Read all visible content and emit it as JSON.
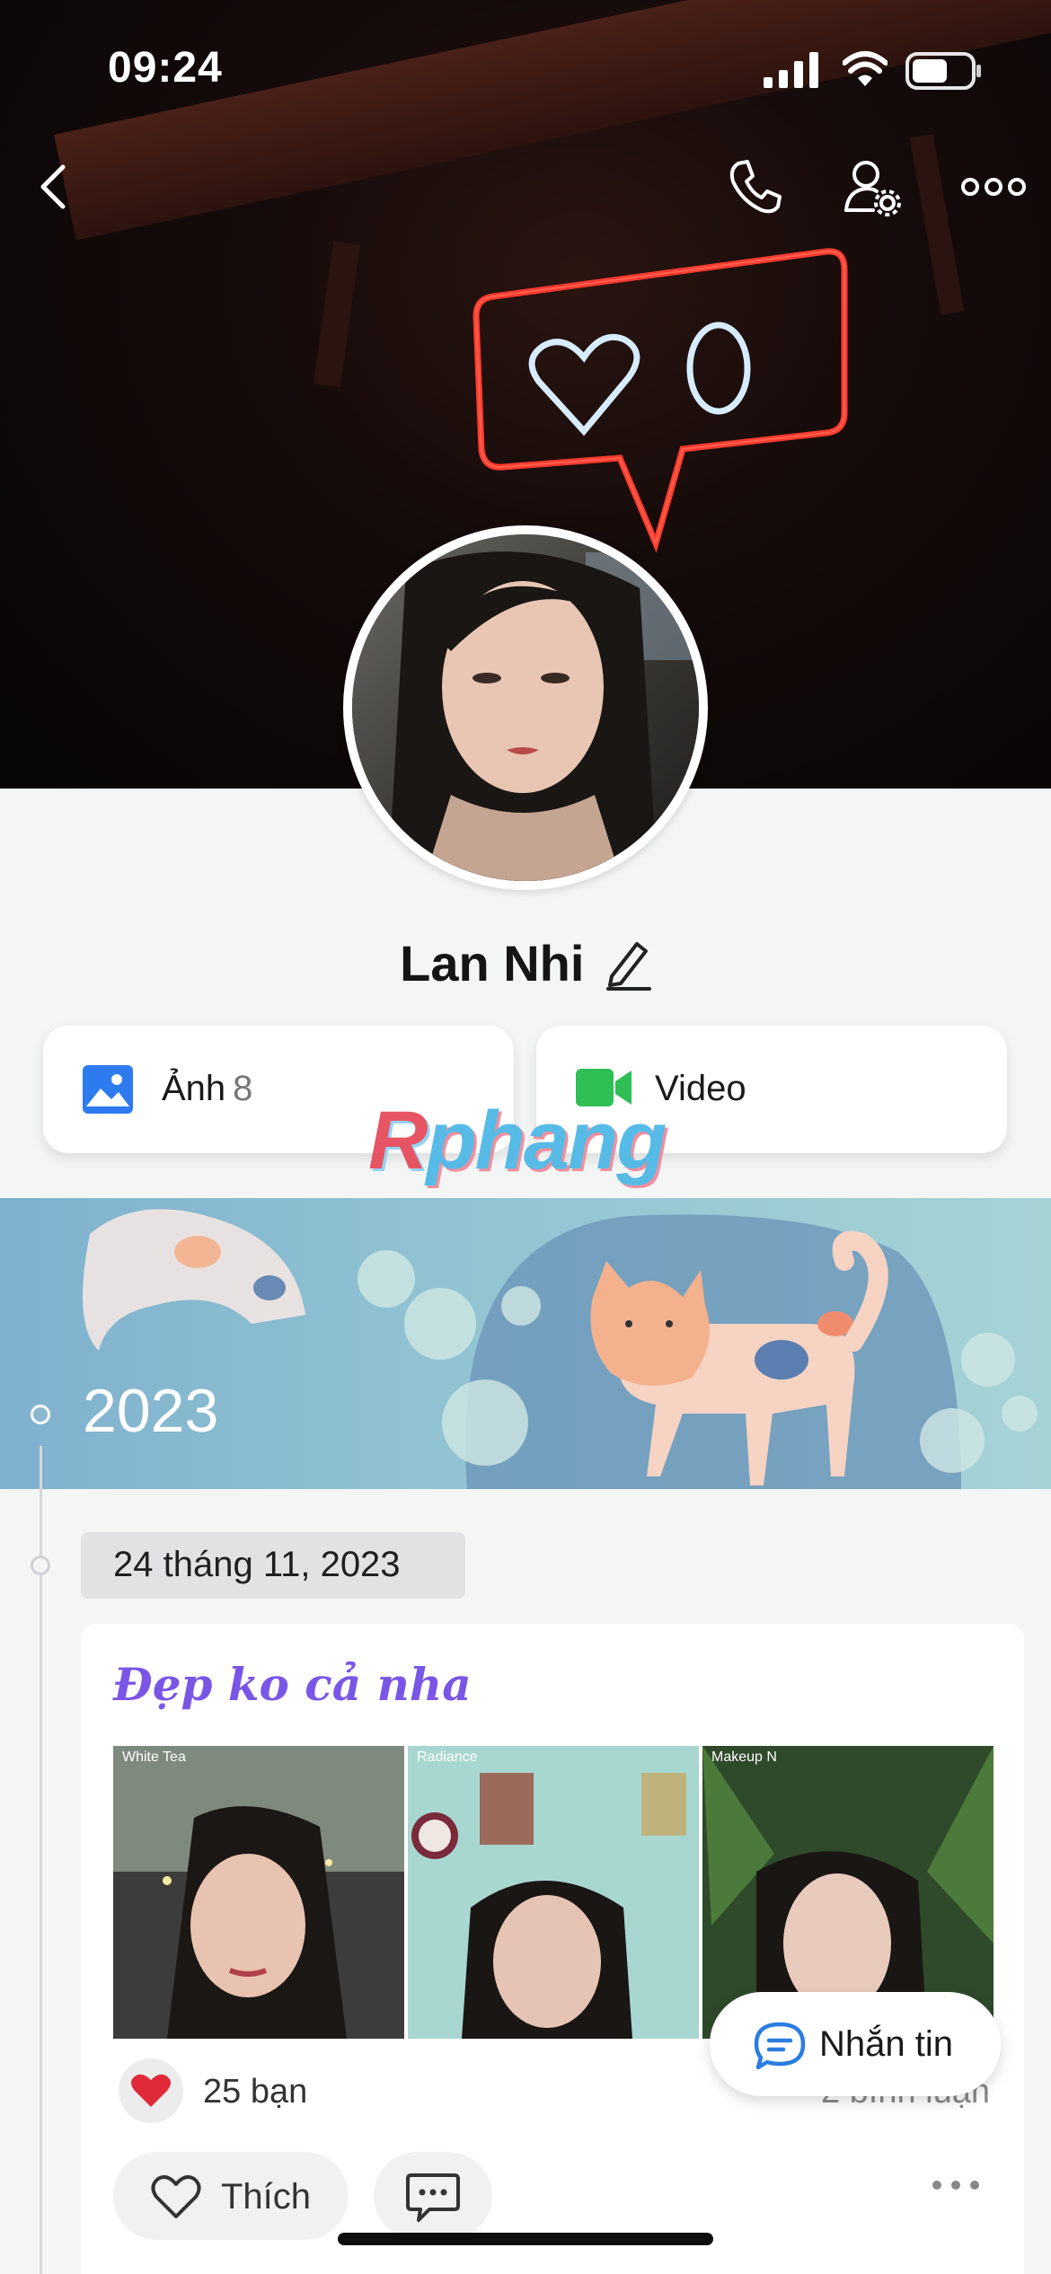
{
  "status_bar": {
    "time": "09:24"
  },
  "profile": {
    "name": "Lan Nhi"
  },
  "media_cards": [
    {
      "label": "Ảnh",
      "count": "8",
      "icon": "photo-icon"
    },
    {
      "label": "Video",
      "icon": "video-icon"
    }
  ],
  "watermark": {
    "part1": "R",
    "part2": "phang"
  },
  "timeline": {
    "year": "2023",
    "date": "24 tháng 11, 2023"
  },
  "post": {
    "title": "Đẹp ko cả nha",
    "photo_tags": [
      "White Tea",
      "Radiance",
      "Makeup N"
    ],
    "likes_text": "25 bạn",
    "comments_text": "2 bình luận",
    "like_button": "Thích"
  },
  "chat_button": {
    "label": "Nhắn tin"
  },
  "colors": {
    "accent": "#7a56e6",
    "chat_blue": "#2a7de1",
    "photo_blue": "#2e7bf0",
    "video_green": "#2fbf54"
  }
}
